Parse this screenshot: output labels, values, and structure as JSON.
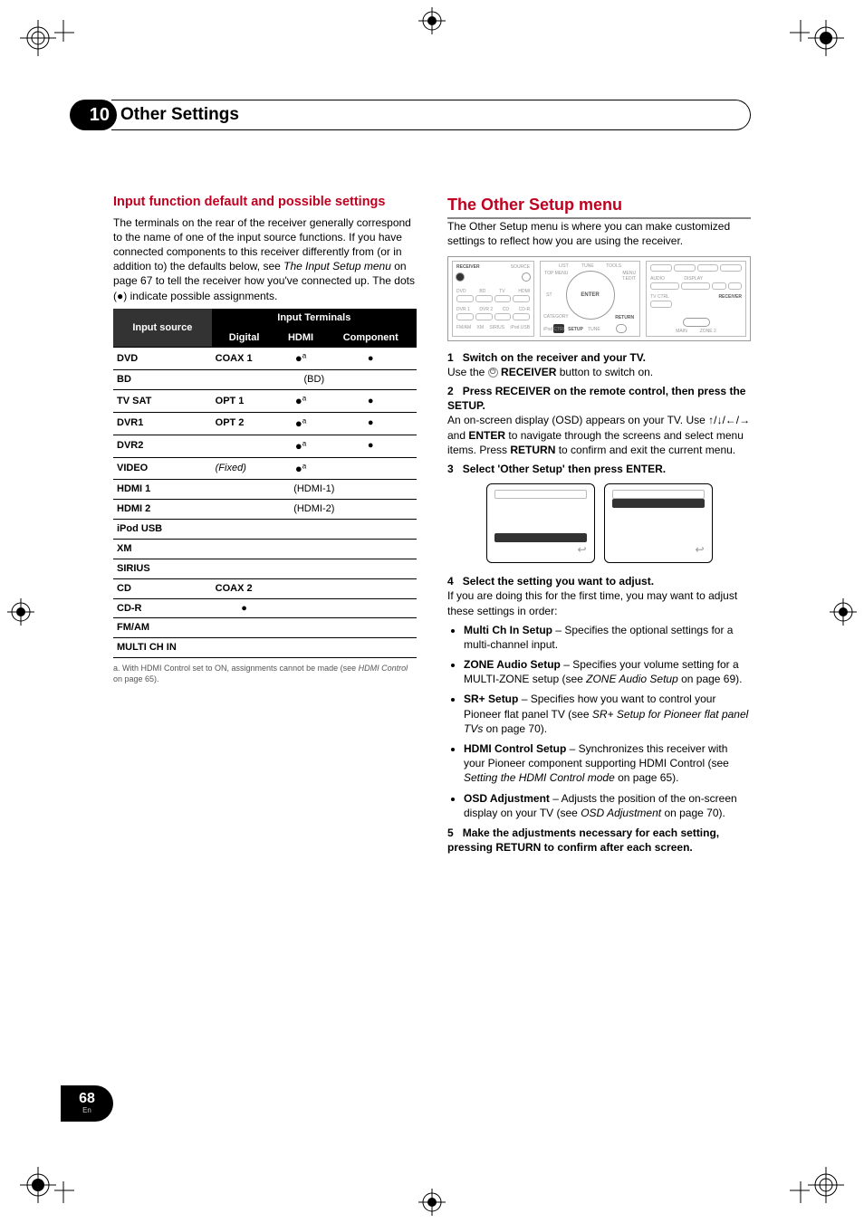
{
  "chapter": {
    "number": "10",
    "title": "Other Settings"
  },
  "left": {
    "heading": "Input function default and possible settings",
    "intro_a": "The terminals on the rear of the receiver generally correspond to the name of one of the input source functions. If you have connected components to this receiver differently from (or in addition to) the defaults below, see ",
    "intro_link": "The Input Setup menu",
    "intro_b": " on page 67 to tell the receiver how you've connected up. The dots (●) indicate possible assignments.",
    "table": {
      "header_group": "Input Terminals",
      "header_rowhead": "Input source",
      "cols": [
        "Digital",
        "HDMI",
        "Component"
      ],
      "rows": [
        {
          "src": "DVD",
          "digital": "COAX 1",
          "hdmi": "●",
          "hdmi_sup": "a",
          "component": "●"
        },
        {
          "src": "BD",
          "span_text": "(BD)"
        },
        {
          "src": "TV SAT",
          "digital": "OPT 1",
          "hdmi": "●",
          "hdmi_sup": "a",
          "component": "●"
        },
        {
          "src": "DVR1",
          "digital": "OPT 2",
          "hdmi": "●",
          "hdmi_sup": "a",
          "component": "●"
        },
        {
          "src": "DVR2",
          "digital": "",
          "hdmi": "●",
          "hdmi_sup": "a",
          "component": "●"
        },
        {
          "src": "VIDEO",
          "digital_italic": "(Fixed)",
          "hdmi": "●",
          "hdmi_sup": "a",
          "component": ""
        },
        {
          "src": "HDMI 1",
          "span_text": "(HDMI-1)"
        },
        {
          "src": "HDMI 2",
          "span_text": "(HDMI-2)"
        },
        {
          "src": "iPod USB"
        },
        {
          "src": "XM"
        },
        {
          "src": "SIRIUS"
        },
        {
          "src": "CD",
          "digital": "COAX 2"
        },
        {
          "src": "CD-R",
          "digital": "●"
        },
        {
          "src": "FM/AM"
        },
        {
          "src": "MULTI CH IN"
        }
      ]
    },
    "footnote_a": "a. With HDMI Control set to ON, assignments cannot be made (see ",
    "footnote_link": "HDMI Control",
    "footnote_b": " on page 65)."
  },
  "right": {
    "heading": "The Other Setup menu",
    "intro": "The Other Setup menu is where you can make customized settings to reflect how you are using the receiver.",
    "remote_labels": {
      "receiver": "RECEIVER",
      "source": "SOURCE",
      "dvd": "DVD",
      "bd": "BD",
      "tv": "TV",
      "hdmi": "HDMI",
      "dvr1": "DVR 1",
      "dvr2": "DVR 2",
      "cd": "CD",
      "cdr": "CD-R",
      "fmam": "FM/AM",
      "xm": "XM",
      "sirius": "SIRIUS",
      "ipod": "iPod USB",
      "enter": "ENTER",
      "setup": "SETUP",
      "return": "RETURN",
      "audio": "AUDIO",
      "display": "DISPLAY",
      "tvctrl": "TV CTRL",
      "main": "MAIN",
      "zone2": "ZONE 2",
      "tune": "TUNE",
      "tools": "TOOLS",
      "topmenu": "TOP MENU",
      "menu": "MENU",
      "edit": "T.EDIT",
      "list": "LIST",
      "category": "CATEGORY",
      "ipodctrl": "iPod CTRL",
      "st": "ST"
    },
    "step1_num": "1",
    "step1_title": "Switch on the receiver and your TV.",
    "step1_body_a": "Use the ",
    "step1_body_b": " RECEIVER",
    "step1_body_c": " button to switch on.",
    "step2_num": "2",
    "step2_title": "Press RECEIVER on the remote control, then press the SETUP.",
    "step2_body_a": "An on-screen display (OSD) appears on your TV. Use ",
    "step2_arrows": "↑/↓/←/→",
    "step2_body_b": " and ",
    "step2_enter": "ENTER",
    "step2_body_c": " to navigate through the screens and select menu items. Press ",
    "step2_return": "RETURN",
    "step2_body_d": " to confirm and exit the current menu.",
    "step3_num": "3",
    "step3_title": "Select 'Other Setup' then press ENTER.",
    "step4_num": "4",
    "step4_title": "Select the setting you want to adjust.",
    "step4_body": "If you are doing this for the first time, you may want to adjust these settings in order:",
    "bullets": [
      {
        "name": "Multi Ch In Setup",
        "body": " – Specifies the optional settings for a multi-channel input."
      },
      {
        "name": "ZONE Audio Setup",
        "body_a": " – Specifies your volume setting for a MULTI-ZONE setup (see ",
        "link": "ZONE Audio Setup",
        "body_b": " on page 69)."
      },
      {
        "name": "SR+ Setup",
        "body_a": " – Specifies how you want to control your Pioneer flat panel TV (see ",
        "link": "SR+ Setup for Pioneer flat panel TVs",
        "body_b": " on page 70)."
      },
      {
        "name": "HDMI Control Setup",
        "body_a": " – Synchronizes this receiver with your Pioneer component supporting HDMI Control (see ",
        "link": "Setting the HDMI Control mode",
        "body_b": " on page 65)."
      },
      {
        "name": "OSD Adjustment",
        "body_a": " – Adjusts the position of the on-screen display on your TV (see ",
        "link": "OSD Adjustment",
        "body_b": " on page 70)."
      }
    ],
    "step5_num": "5",
    "step5_title": "Make the adjustments necessary for each setting, pressing RETURN to confirm after each screen."
  },
  "page": {
    "number": "68",
    "lang": "En"
  }
}
